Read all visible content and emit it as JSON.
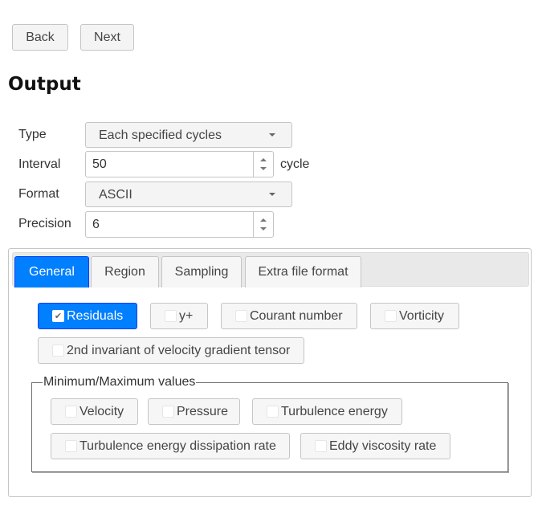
{
  "nav": {
    "back_label": "Back",
    "next_label": "Next"
  },
  "page_title": "Output",
  "form": {
    "type": {
      "label": "Type",
      "value": "Each specified cycles"
    },
    "interval": {
      "label": "Interval",
      "value": "50",
      "unit": "cycle"
    },
    "format": {
      "label": "Format",
      "value": "ASCII"
    },
    "precision": {
      "label": "Precision",
      "value": "6"
    }
  },
  "tabs": [
    {
      "label": "General",
      "active": true
    },
    {
      "label": "Region",
      "active": false
    },
    {
      "label": "Sampling",
      "active": false
    },
    {
      "label": "Extra file format",
      "active": false
    }
  ],
  "general": {
    "options": [
      {
        "label": "Residuals",
        "checked": true
      },
      {
        "label": "y+",
        "checked": false
      },
      {
        "label": "Courant number",
        "checked": false
      },
      {
        "label": "Vorticity",
        "checked": false
      },
      {
        "label": "2nd invariant of velocity gradient tensor",
        "checked": false
      }
    ],
    "minmax": {
      "legend": "Minimum/Maximum values",
      "options": [
        {
          "label": "Velocity",
          "checked": false
        },
        {
          "label": "Pressure",
          "checked": false
        },
        {
          "label": "Turbulence energy",
          "checked": false
        },
        {
          "label": "Turbulence energy dissipation rate",
          "checked": false
        },
        {
          "label": "Eddy viscosity rate",
          "checked": false
        }
      ]
    }
  },
  "colors": {
    "accent": "#007fff"
  }
}
